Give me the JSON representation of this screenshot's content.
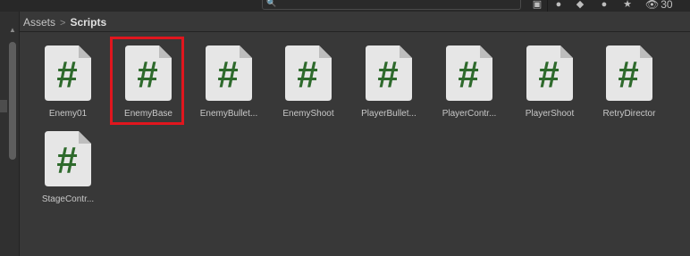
{
  "toolbar": {
    "search_value": "",
    "icons": [
      "search-icon",
      "scene-lock-icon",
      "asset-type-icon",
      "label-tag-icon",
      "error-icon",
      "favorite-star-icon",
      "eye-icon"
    ],
    "visible_count": "30"
  },
  "breadcrumb": {
    "root": "Assets",
    "separator": ">",
    "current": "Scripts"
  },
  "assets": [
    {
      "label": "Enemy01",
      "selected": false
    },
    {
      "label": "EnemyBase",
      "selected": true
    },
    {
      "label": "EnemyBullet...",
      "selected": false
    },
    {
      "label": "EnemyShoot",
      "selected": false
    },
    {
      "label": "PlayerBullet...",
      "selected": false
    },
    {
      "label": "PlayerContr...",
      "selected": false
    },
    {
      "label": "PlayerShoot",
      "selected": false
    },
    {
      "label": "RetryDirector",
      "selected": false
    },
    {
      "label": "StageContr...",
      "selected": false
    }
  ],
  "colors": {
    "background": "#383838",
    "hash_green": "#2e6a2c",
    "file_paper": "#e6e6e6",
    "selection_highlight": "#e0161e"
  },
  "file_glyph": "#"
}
